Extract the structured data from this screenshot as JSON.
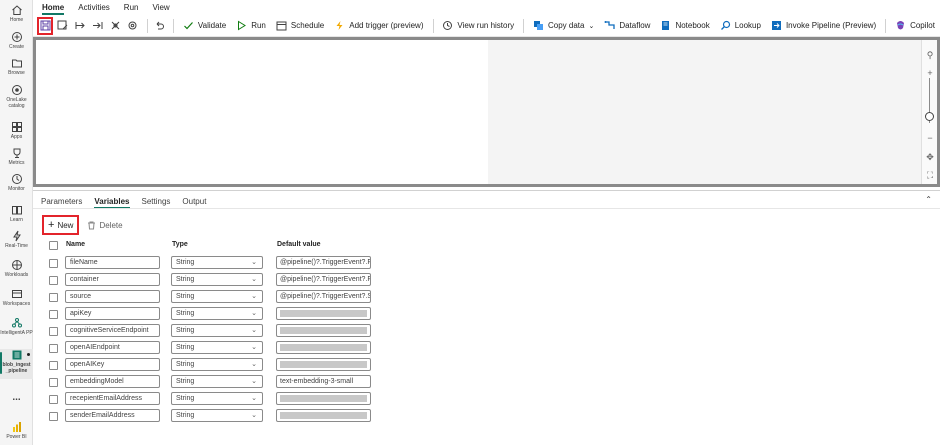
{
  "rail": [
    {
      "label": "Home",
      "icon": "home-icon"
    },
    {
      "label": "Create",
      "icon": "create-icon"
    },
    {
      "label": "Browse",
      "icon": "browse-icon"
    },
    {
      "label": "OneLake catalog",
      "icon": "onelake-icon"
    },
    {
      "label": "Apps",
      "icon": "apps-icon"
    },
    {
      "label": "Metrics",
      "icon": "metrics-icon"
    },
    {
      "label": "Monitor",
      "icon": "monitor-icon"
    },
    {
      "label": "Learn",
      "icon": "learn-icon"
    },
    {
      "label": "Real-Time",
      "icon": "realtime-icon"
    },
    {
      "label": "Workloads",
      "icon": "workloads-icon"
    },
    {
      "label": "Workspaces",
      "icon": "workspaces-icon"
    },
    {
      "label": "IntelligentA PP",
      "icon": "intelligent-app-icon"
    },
    {
      "label": "blob_ingest _pipeline",
      "icon": "pipeline-icon"
    },
    {
      "label": "...",
      "icon": "more-icon"
    },
    {
      "label": "Power BI",
      "icon": "powerbi-icon"
    }
  ],
  "menu_tabs": [
    "Home",
    "Activities",
    "Run",
    "View"
  ],
  "toolbar": {
    "validate": "Validate",
    "run": "Run",
    "schedule": "Schedule",
    "add_trigger": "Add trigger (preview)",
    "view_run_history": "View run history",
    "copy_data": "Copy data",
    "dataflow": "Dataflow",
    "notebook": "Notebook",
    "lookup": "Lookup",
    "invoke_pipeline": "Invoke Pipeline (Preview)",
    "copilot": "Copilot"
  },
  "panel": {
    "tabs": [
      "Parameters",
      "Variables",
      "Settings",
      "Output"
    ],
    "new_label": "New",
    "delete_label": "Delete",
    "headers": {
      "name": "Name",
      "type": "Type",
      "default": "Default value"
    },
    "rows": [
      {
        "name": "fileName",
        "type": "String",
        "value": "@pipeline()?.TriggerEvent?.Fi..."
      },
      {
        "name": "container",
        "type": "String",
        "value": "@pipeline()?.TriggerEvent?.F..."
      },
      {
        "name": "source",
        "type": "String",
        "value": "@pipeline()?.TriggerEvent?.S..."
      },
      {
        "name": "apiKey",
        "type": "String",
        "value": ""
      },
      {
        "name": "cognitiveServiceEndpoint",
        "type": "String",
        "value": ""
      },
      {
        "name": "openAIEndpoint",
        "type": "String",
        "value": ""
      },
      {
        "name": "openAIKey",
        "type": "String",
        "value": ""
      },
      {
        "name": "embeddingModel",
        "type": "String",
        "value": "text-embedding-3-small"
      },
      {
        "name": "recepientEmailAddress",
        "type": "String",
        "value": ""
      },
      {
        "name": "senderEmailAddress",
        "type": "String",
        "value": ""
      }
    ]
  },
  "colors": {
    "accent": "#117865",
    "highlight": "#e3242b"
  }
}
